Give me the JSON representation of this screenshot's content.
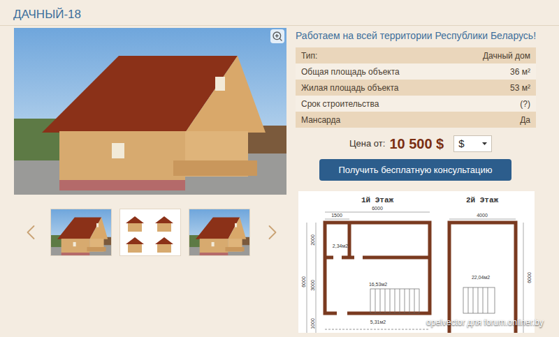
{
  "title": "ДАЧНЫЙ-18",
  "gallery": {
    "thumbnails": [
      {
        "kind": "photo"
      },
      {
        "kind": "facades"
      },
      {
        "kind": "photo"
      }
    ]
  },
  "region_note": "Работаем на всей территории Республики Беларусь!",
  "specs": [
    {
      "label": "Тип:",
      "value": "Дачный дом"
    },
    {
      "label": "Общая площадь объекта",
      "value": "36 м²"
    },
    {
      "label": "Жилая площадь объекта",
      "value": "53 м²"
    },
    {
      "label": "Срок строительства",
      "value": "(?)"
    },
    {
      "label": "Мансарда",
      "value": "Да"
    }
  ],
  "price": {
    "label": "Цена от:",
    "value": "10 500 $"
  },
  "currency": {
    "value": "$"
  },
  "consult_button": "Получить бесплатную консультацию",
  "plan": {
    "floor1": {
      "title": "1й Этаж",
      "width": "6000",
      "closet_width": "1500",
      "depth": "6000",
      "side_dims": [
        "2000",
        "3000",
        "1000"
      ],
      "rooms": [
        "2,34м2",
        "16,53м2",
        "5,31м2"
      ]
    },
    "floor2": {
      "title": "2й Этаж",
      "width": "4000",
      "depth": "6000",
      "rooms": [
        "22,04м2"
      ]
    }
  },
  "watermark": "opelvector для forum.onliner.by"
}
